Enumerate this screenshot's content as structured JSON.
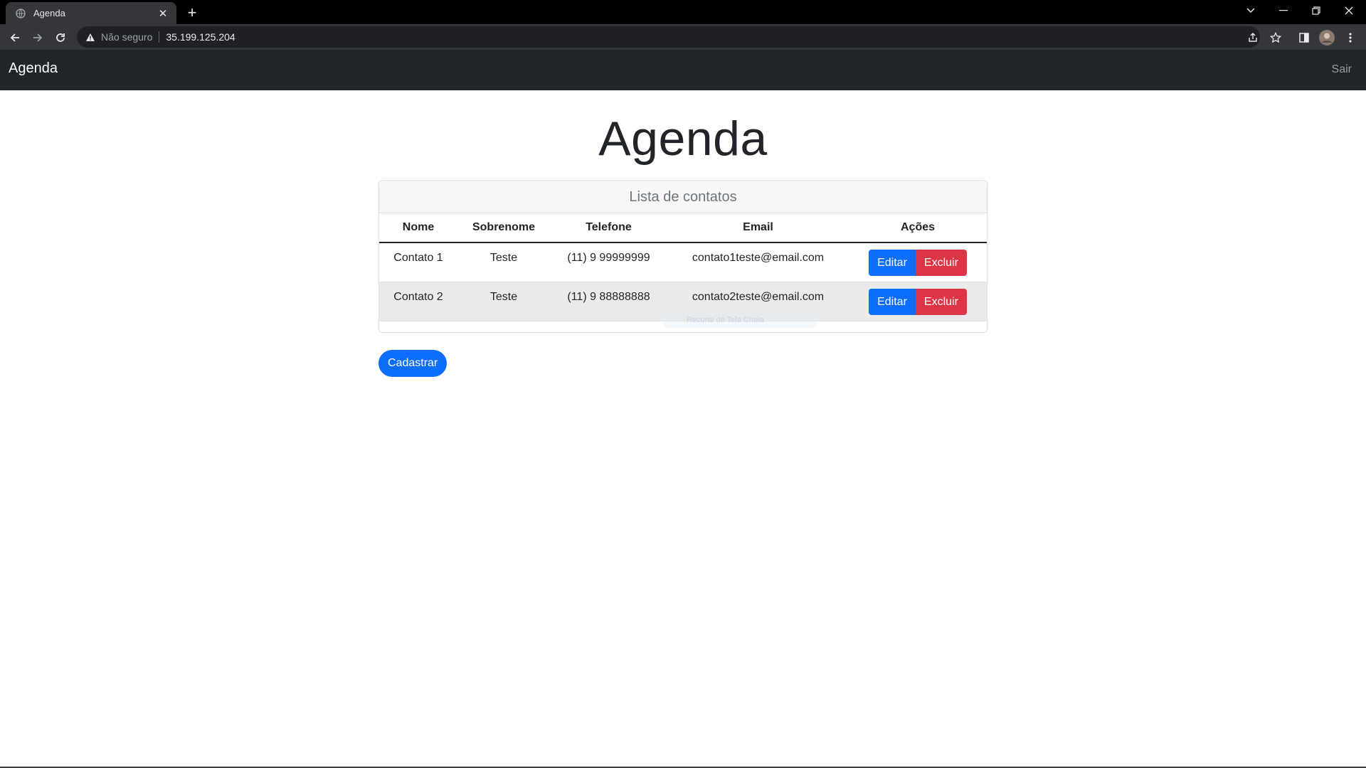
{
  "browser": {
    "tab_title": "Agenda",
    "tab_close": "✕",
    "new_tab": "+",
    "security_label": "Não seguro",
    "url": "35.199.125.204"
  },
  "navbar": {
    "brand": "Agenda",
    "logout": "Sair"
  },
  "main": {
    "heading": "Agenda",
    "card_title": "Lista de contatos",
    "columns": [
      "Nome",
      "Sobrenome",
      "Telefone",
      "Email",
      "Ações"
    ],
    "rows": [
      {
        "nome": "Contato 1",
        "sobrenome": "Teste",
        "telefone": "(11) 9 99999999",
        "email": "contato1teste@email.com"
      },
      {
        "nome": "Contato 2",
        "sobrenome": "Teste",
        "telefone": "(11) 9 88888888",
        "email": "contato2teste@email.com"
      }
    ],
    "edit_label": "Editar",
    "delete_label": "Excluir",
    "register_label": "Cadastrar",
    "overlay_text": "Recorte de Tela Cheia"
  },
  "colors": {
    "navbar_bg": "#212529",
    "primary": "#0d6efd",
    "danger": "#dc3545"
  }
}
